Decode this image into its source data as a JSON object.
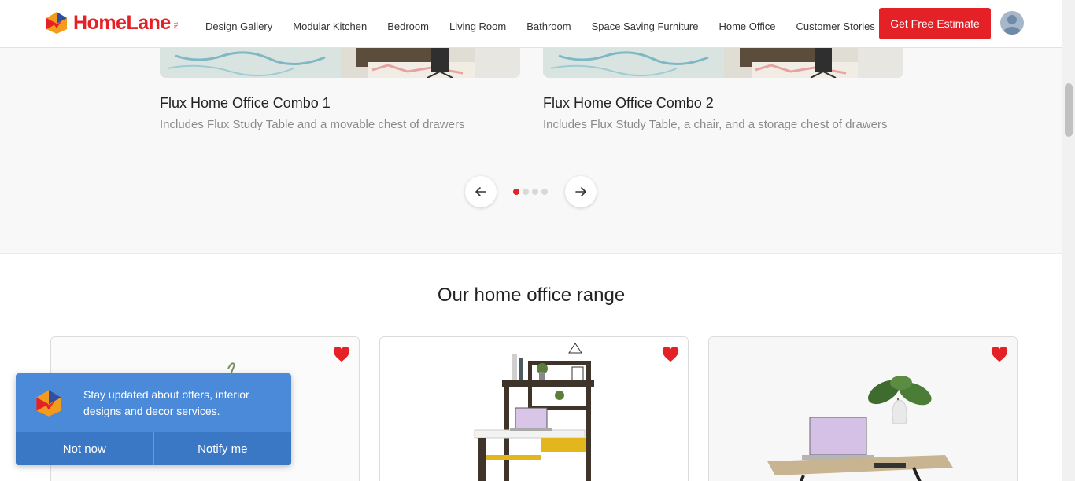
{
  "header": {
    "brand": "HomeLane",
    "brand_tm": "TM",
    "nav": [
      "Design Gallery",
      "Modular Kitchen",
      "Bedroom",
      "Living Room",
      "Bathroom",
      "Space Saving Furniture",
      "Home Office",
      "Customer Stories"
    ],
    "cta_label": "Get Free Estimate",
    "icons": {
      "avatar": "user-avatar-icon"
    }
  },
  "carousel": {
    "slides": [
      {
        "title": "Flux Home Office Combo 1",
        "description": "Includes Flux Study Table and a movable chest of drawers"
      },
      {
        "title": "Flux Home Office Combo 2",
        "description": "Includes Flux Study Table, a chair, and a storage chest of drawers"
      }
    ],
    "dot_count": 4,
    "active_dot": 1,
    "icons": {
      "prev": "arrow-left-icon",
      "next": "arrow-right-icon"
    }
  },
  "range": {
    "title": "Our home office range",
    "cards": [
      {
        "wishlisted": true
      },
      {
        "wishlisted": true
      },
      {
        "wishlisted": true
      }
    ]
  },
  "notification": {
    "message": "Stay updated about offers, interior designs and decor services.",
    "dismiss_label": "Not now",
    "accept_label": "Notify me"
  },
  "colors": {
    "brand_red": "#e42127",
    "popup_blue": "#4a8ad8",
    "popup_button_blue": "#3a78c6"
  }
}
